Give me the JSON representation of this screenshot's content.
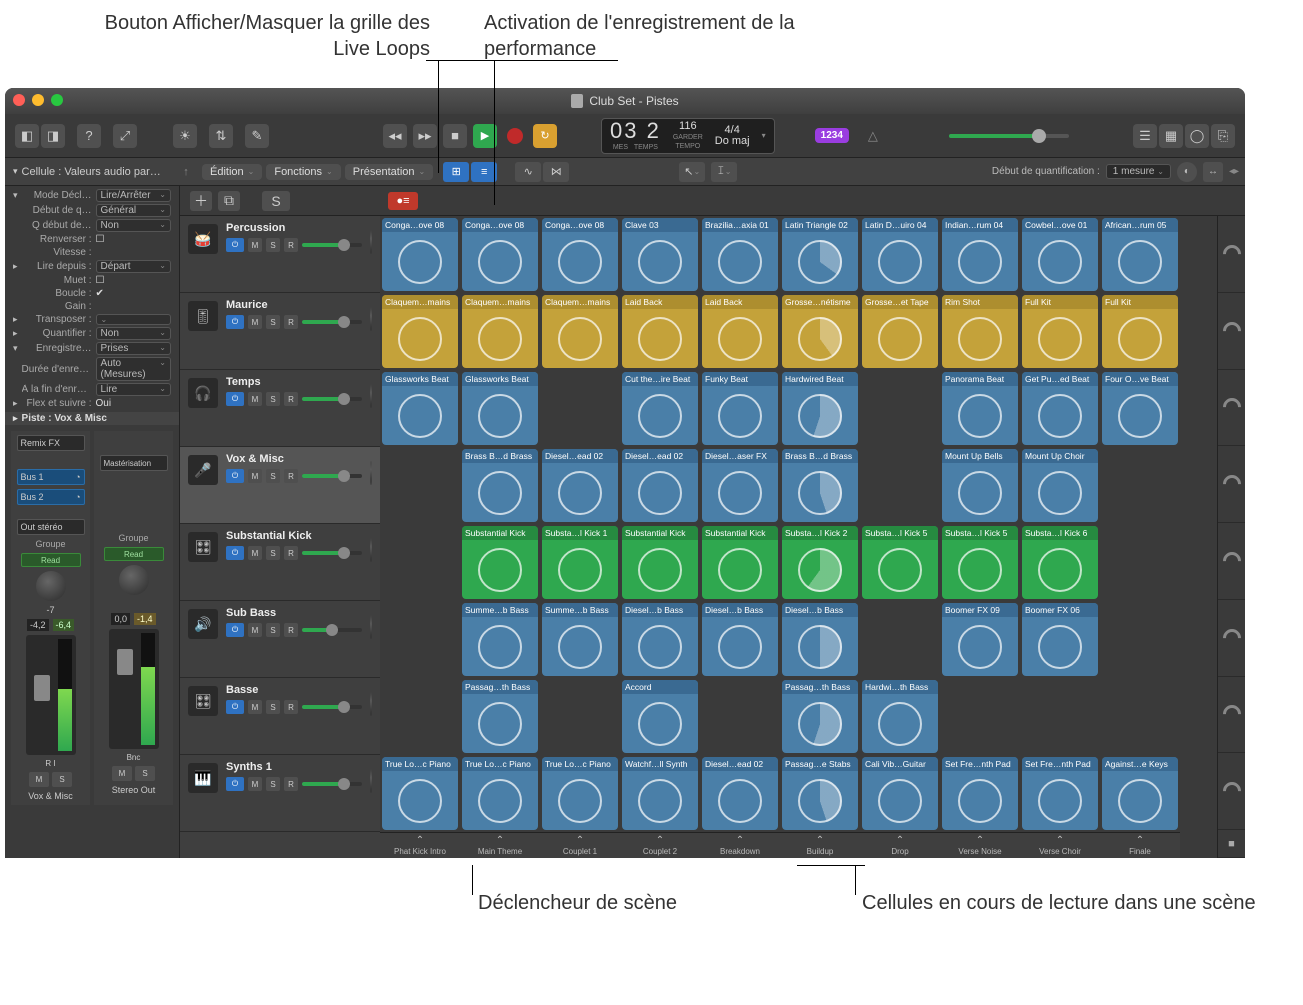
{
  "callouts": {
    "c1": "Bouton Afficher/Masquer la grille des Live Loops",
    "c2": "Activation de l'enregistrement de la performance",
    "c3": "Déclencheur de scène",
    "c4": "Cellules en cours de lecture dans une scène"
  },
  "colors": {
    "red": "#ff5f57",
    "yellow": "#febc2e",
    "green": "#28c840"
  },
  "title": "Club Set - Pistes",
  "lcd": {
    "bars": "03 2",
    "mes": "MES",
    "temps": "TEMPS",
    "bpm": "116",
    "garder": "GARDER",
    "tempo": "TEMPO",
    "sig": "4/4",
    "key": "Do maj"
  },
  "purple": "1234",
  "inspector": {
    "header": "Cellule : Valeurs audio par…",
    "rows": [
      {
        "k": "Mode Décl…",
        "v": "Lire/Arrêter",
        "sel": true,
        "tri": "▾"
      },
      {
        "k": "Début de q…",
        "v": "Général",
        "sel": true
      },
      {
        "k": "Q début de…",
        "v": "Non",
        "sel": true
      },
      {
        "k": "Renverser :",
        "v": "☐"
      },
      {
        "k": "Vitesse :",
        "v": ""
      },
      {
        "k": "Lire depuis :",
        "v": "Départ",
        "sel": true,
        "tri": "▸"
      },
      {
        "k": "Muet :",
        "v": "☐"
      },
      {
        "k": "Boucle :",
        "v": "✔",
        "chk": true
      },
      {
        "k": "Gain :",
        "v": ""
      },
      {
        "k": "Transposer :",
        "v": "",
        "sel": true,
        "tri": "▸"
      },
      {
        "k": "Quantifier :",
        "v": "Non",
        "sel": true,
        "tri": "▸"
      },
      {
        "k": "Enregistre…",
        "v": "Prises",
        "sel": true,
        "tri": "▾"
      },
      {
        "k": "Durée d'enreg. :",
        "v": "Auto (Mesures)",
        "sel": true
      },
      {
        "k": "À la fin d'enreg. :",
        "v": "Lire",
        "sel": true
      },
      {
        "k": "Flex et suivre :",
        "v": "Oui",
        "tri": "▸"
      }
    ],
    "piste_header": "Piste :  Vox & Misc"
  },
  "mixer": {
    "left": {
      "fx": "Remix FX",
      "bus1": "Bus 1",
      "bus2": "Bus 2",
      "out": "Out stéréo",
      "group": "Groupe",
      "read": "Read",
      "pan": "-7",
      "db1": "-4,2",
      "db2": "-6,4",
      "route": "R  I",
      "name": "Vox & Misc"
    },
    "right": {
      "master": "Mastérisation",
      "group": "Groupe",
      "read": "Read",
      "db1": "0,0",
      "db2": "-1,4",
      "route": "Bnc",
      "name": "Stereo Out"
    }
  },
  "menus": {
    "edition": "Édition",
    "fonctions": "Fonctions",
    "presentation": "Présentation"
  },
  "quant": {
    "label": "Début de quantification :",
    "value": "1 mesure"
  },
  "addSolo": "S",
  "tracks": [
    {
      "name": "Percussion",
      "icon": "🥁",
      "vfill": 70
    },
    {
      "name": "Maurice",
      "icon": "🎚",
      "vfill": 70
    },
    {
      "name": "Temps",
      "icon": "🎧",
      "vfill": 70
    },
    {
      "name": "Vox & Misc",
      "icon": "🎤",
      "sel": true,
      "vfill": 70
    },
    {
      "name": "Substantial Kick",
      "icon": "🎛",
      "vfill": 70
    },
    {
      "name": "Sub Bass",
      "icon": "🔊",
      "vfill": 50
    },
    {
      "name": "Basse",
      "icon": "🎛",
      "vfill": 70
    },
    {
      "name": "Synths 1",
      "icon": "🎹",
      "vfill": 70
    }
  ],
  "scenes": [
    "Phat Kick Intro",
    "Main Theme",
    "Couplet 1",
    "Couplet 2",
    "Breakdown",
    "Buildup",
    "Drop",
    "Verse Noise",
    "Verse Choir",
    "Finale"
  ],
  "grid": [
    [
      [
        "Conga…ove 08",
        "b"
      ],
      [
        "Conga…ove 08",
        "b"
      ],
      [
        "Conga…ove 08",
        "b"
      ],
      [
        "Clave 03",
        "b"
      ],
      [
        "Brazilia…axia 01",
        "b"
      ],
      [
        "Latin Triangle 02",
        "b",
        "p35"
      ],
      [
        "Latin D…uiro 04",
        "b"
      ],
      [
        "Indian…rum 04",
        "b"
      ],
      [
        "Cowbel…ove 01",
        "b"
      ],
      [
        "African…rum 05",
        "b"
      ]
    ],
    [
      [
        "Claquem…mains",
        "y"
      ],
      [
        "Claquem…mains",
        "y"
      ],
      [
        "Claquem…mains",
        "y"
      ],
      [
        "Laid Back",
        "y"
      ],
      [
        "Laid Back",
        "y"
      ],
      [
        "Grosse…nétisme",
        "y",
        "p40"
      ],
      [
        "Grosse…et Tape",
        "y"
      ],
      [
        "Rim Shot",
        "y"
      ],
      [
        "Full Kit",
        "y"
      ],
      [
        "Full Kit",
        "y"
      ]
    ],
    [
      [
        "Glassworks Beat",
        "b"
      ],
      [
        "Glassworks Beat",
        "b"
      ],
      [
        "",
        "e"
      ],
      [
        "Cut the…ire Beat",
        "b"
      ],
      [
        "Funky Beat",
        "b"
      ],
      [
        "Hardwired Beat",
        "b",
        "p55"
      ],
      [
        "",
        "e"
      ],
      [
        "Panorama Beat",
        "b"
      ],
      [
        "Get Pu…ed Beat",
        "b"
      ],
      [
        "Four O…ve Beat",
        "b"
      ]
    ],
    [
      [
        "",
        "e"
      ],
      [
        "Brass B…d Brass",
        "b"
      ],
      [
        "Diesel…ead 02",
        "b"
      ],
      [
        "Diesel…ead 02",
        "b"
      ],
      [
        "Diesel…aser FX",
        "b"
      ],
      [
        "Brass B…d Brass",
        "b",
        "p45"
      ],
      [
        "",
        "e"
      ],
      [
        "Mount Up Bells",
        "b"
      ],
      [
        "Mount Up Choir",
        "b"
      ],
      [
        "",
        "e"
      ]
    ],
    [
      [
        "",
        "e"
      ],
      [
        "Substantial Kick",
        "g"
      ],
      [
        "Substa…l Kick 1",
        "g"
      ],
      [
        "Substantial Kick",
        "g"
      ],
      [
        "Substantial Kick",
        "g"
      ],
      [
        "Substa…l Kick 2",
        "g",
        "p60"
      ],
      [
        "Substa…l Kick 5",
        "g"
      ],
      [
        "Substa…l Kick 5",
        "g"
      ],
      [
        "Substa…l Kick 6",
        "g"
      ],
      [
        "",
        "e"
      ]
    ],
    [
      [
        "",
        "e"
      ],
      [
        "Summe…b Bass",
        "b"
      ],
      [
        "Summe…b Bass",
        "b"
      ],
      [
        "Diesel…b Bass",
        "b"
      ],
      [
        "Diesel…b Bass",
        "b"
      ],
      [
        "Diesel…b Bass",
        "b",
        "p50"
      ],
      [
        "",
        "e"
      ],
      [
        "Boomer FX 09",
        "b"
      ],
      [
        "Boomer FX 06",
        "b"
      ],
      [
        "",
        "e"
      ]
    ],
    [
      [
        "",
        "e"
      ],
      [
        "Passag…th Bass",
        "b"
      ],
      [
        "",
        "e"
      ],
      [
        "Accord",
        "b"
      ],
      [
        "",
        "e"
      ],
      [
        "Passag…th Bass",
        "b",
        "p55"
      ],
      [
        "Hardwi…th Bass",
        "b"
      ],
      [
        "",
        "e"
      ],
      [
        "",
        "e"
      ],
      [
        "",
        "e"
      ]
    ],
    [
      [
        "True Lo…c Piano",
        "b"
      ],
      [
        "True Lo…c Piano",
        "b"
      ],
      [
        "True Lo…c Piano",
        "b"
      ],
      [
        "Watchf…ll Synth",
        "b"
      ],
      [
        "Diesel…ead 02",
        "b"
      ],
      [
        "Passag…e Stabs",
        "b",
        "p45"
      ],
      [
        "Cali Vib…Guitar",
        "b"
      ],
      [
        "Set Fre…nth Pad",
        "b"
      ],
      [
        "Set Fre…nth Pad",
        "b"
      ],
      [
        "Against…e Keys",
        "b"
      ]
    ]
  ]
}
